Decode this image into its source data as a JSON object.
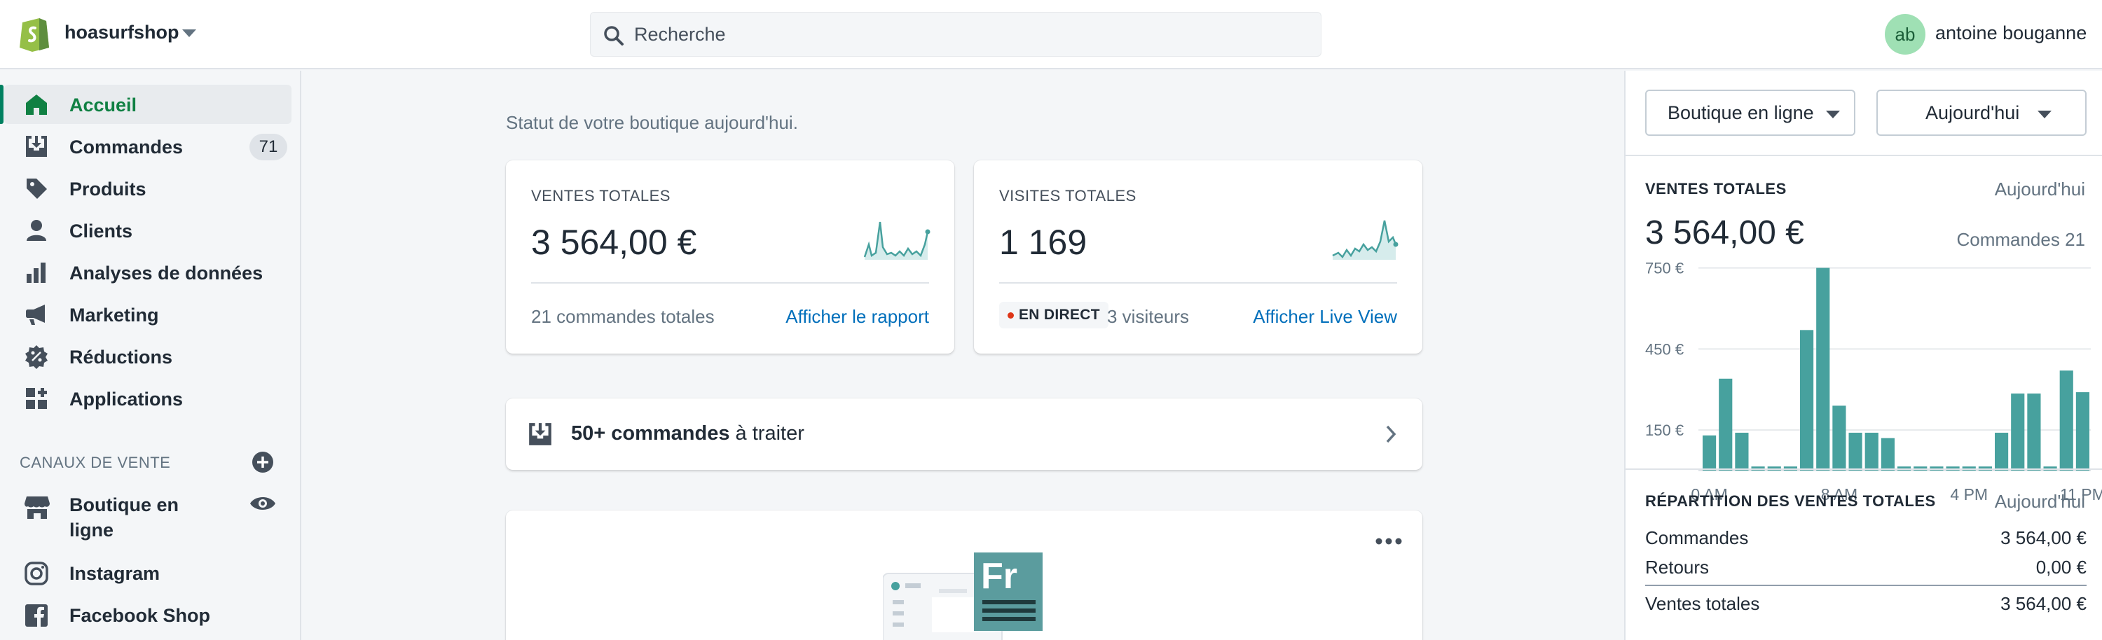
{
  "topbar": {
    "shop_name": "hoasurfshop",
    "search_placeholder": "Recherche",
    "user_initials": "ab",
    "user_name": "antoine bouganne"
  },
  "colors": {
    "accent_green": "#108043",
    "link_blue": "#006fbb",
    "chart_teal": "#47a19e",
    "live_red": "#de3618"
  },
  "sidebar": {
    "items": [
      {
        "label": "Accueil",
        "icon": "home-icon",
        "active": true
      },
      {
        "label": "Commandes",
        "icon": "orders-icon",
        "badge": "71"
      },
      {
        "label": "Produits",
        "icon": "tag-icon"
      },
      {
        "label": "Clients",
        "icon": "person-icon"
      },
      {
        "label": "Analyses de données",
        "icon": "bar-chart-icon"
      },
      {
        "label": "Marketing",
        "icon": "megaphone-icon"
      },
      {
        "label": "Réductions",
        "icon": "discount-icon"
      },
      {
        "label": "Applications",
        "icon": "apps-icon"
      }
    ],
    "channels_heading": "CANAUX DE VENTE",
    "channels": [
      {
        "label_line1": "Boutique en",
        "label_line2": "ligne",
        "icon": "store-icon"
      },
      {
        "label": "Instagram",
        "icon": "instagram-icon"
      },
      {
        "label": "Facebook Shop",
        "icon": "facebook-icon"
      }
    ]
  },
  "main": {
    "subtitle": "Statut de votre boutique aujourd'hui.",
    "sales_card": {
      "label": "VENTES TOTALES",
      "value": "3 564,00 €",
      "footer": "21 commandes totales",
      "link": "Afficher le rapport"
    },
    "visits_card": {
      "label": "VISITES TOTALES",
      "value": "1 169",
      "live_badge": "EN DIRECT",
      "visitors": "3 visiteurs",
      "link": "Afficher Live View"
    },
    "todo": {
      "bold": "50+ commandes",
      "rest": " à traiter"
    },
    "promo_tile": {
      "badge_text": "Fr"
    }
  },
  "right_panel": {
    "channel_button": "Boutique en ligne",
    "period_button": "Aujourd'hui",
    "sales": {
      "label": "VENTES TOTALES",
      "period": "Aujourd'hui",
      "value": "3 564,00 €",
      "orders": "Commandes 21"
    },
    "breakdown": {
      "label": "RÉPARTITION DES VENTES TOTALES",
      "period": "Aujourd'hui",
      "rows": [
        {
          "name": "Commandes",
          "value": "3 564,00 €"
        },
        {
          "name": "Retours",
          "value": "0,00 €"
        }
      ],
      "total": {
        "name": "Ventes totales",
        "value": "3 564,00 €"
      }
    }
  },
  "chart_data": {
    "type": "bar",
    "title": "",
    "xlabel": "",
    "ylabel": "",
    "y_ticks": [
      "750 €",
      "450 €",
      "150 €"
    ],
    "y_tick_values": [
      750,
      450,
      150
    ],
    "x_tick_labels": [
      "0 AM",
      "8 AM",
      "4 PM",
      "11 PM"
    ],
    "x_tick_hours": [
      0,
      8,
      16,
      23
    ],
    "ylim": [
      0,
      780
    ],
    "grid": true,
    "color": "#47a19e",
    "series": [
      {
        "name": "",
        "x": [
          0,
          1,
          2,
          3,
          4,
          5,
          6,
          7,
          8,
          9,
          10,
          11,
          12,
          13,
          14,
          15,
          16,
          17,
          18,
          19,
          20,
          21,
          22,
          23
        ],
        "values": [
          130,
          340,
          140,
          15,
          15,
          15,
          520,
          750,
          240,
          140,
          140,
          120,
          15,
          15,
          15,
          15,
          15,
          15,
          140,
          285,
          285,
          15,
          370,
          290
        ]
      }
    ]
  }
}
